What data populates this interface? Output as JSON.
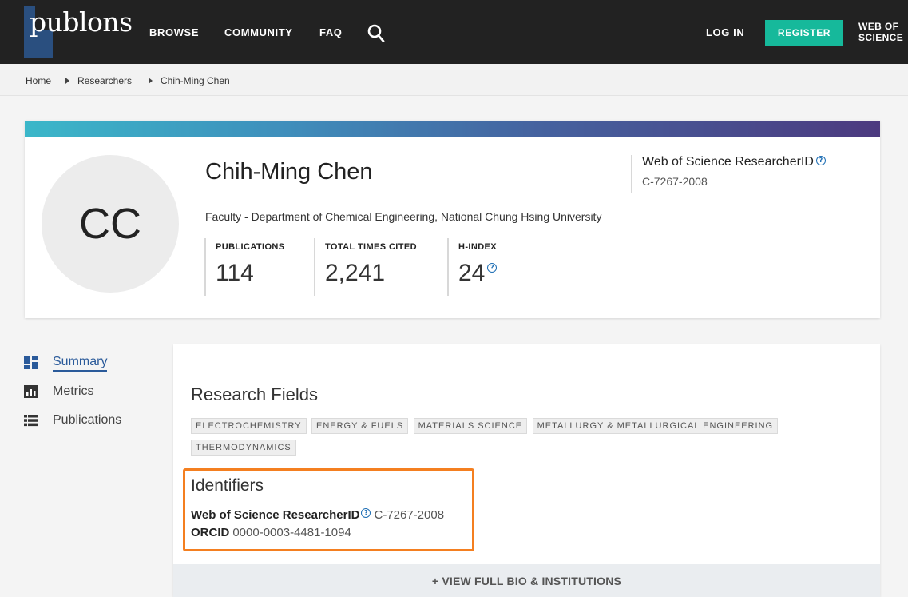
{
  "nav": {
    "logo": "publons",
    "links": [
      "BROWSE",
      "COMMUNITY",
      "FAQ"
    ],
    "login": "LOG IN",
    "register": "REGISTER",
    "wos_line1": "WEB OF",
    "wos_line2": "SCIENCE",
    "search_icon": "search-icon"
  },
  "breadcrumb": [
    "Home",
    "Researchers",
    "Chih-Ming Chen"
  ],
  "profile": {
    "initials": "CC",
    "name": "Chih-Ming Chen",
    "affiliation": "Faculty - Department of Chemical Engineering, National Chung Hsing University",
    "stats": [
      {
        "label": "PUBLICATIONS",
        "value": "114"
      },
      {
        "label": "TOTAL TIMES CITED",
        "value": "2,241"
      },
      {
        "label": "H-INDEX",
        "value": "24"
      }
    ],
    "researcherid_title": "Web of Science ResearcherID",
    "researcherid_value": "C-7267-2008"
  },
  "sidenav": {
    "items": [
      {
        "label": "Summary",
        "icon": "dashboard-icon",
        "active": true
      },
      {
        "label": "Metrics",
        "icon": "bar-chart-icon",
        "active": false
      },
      {
        "label": "Publications",
        "icon": "list-icon",
        "active": false
      }
    ]
  },
  "main": {
    "research_fields_title": "Research Fields",
    "fields": [
      "ELECTROCHEMISTRY",
      "ENERGY & FUELS",
      "MATERIALS SCIENCE",
      "METALLURGY & METALLURGICAL ENGINEERING",
      "THERMODYNAMICS"
    ],
    "identifiers_title": "Identifiers",
    "wos_label": "Web of Science ResearcherID",
    "wos_value": "C-7267-2008",
    "orcid_label": "ORCID",
    "orcid_value": "0000-0003-4481-1094",
    "view_full": "+ VIEW FULL BIO & INSTITUTIONS"
  },
  "colors": {
    "topbar": "#222222",
    "register": "#16b99b",
    "highlight": "#f47f20",
    "link": "#1f6fb5"
  }
}
